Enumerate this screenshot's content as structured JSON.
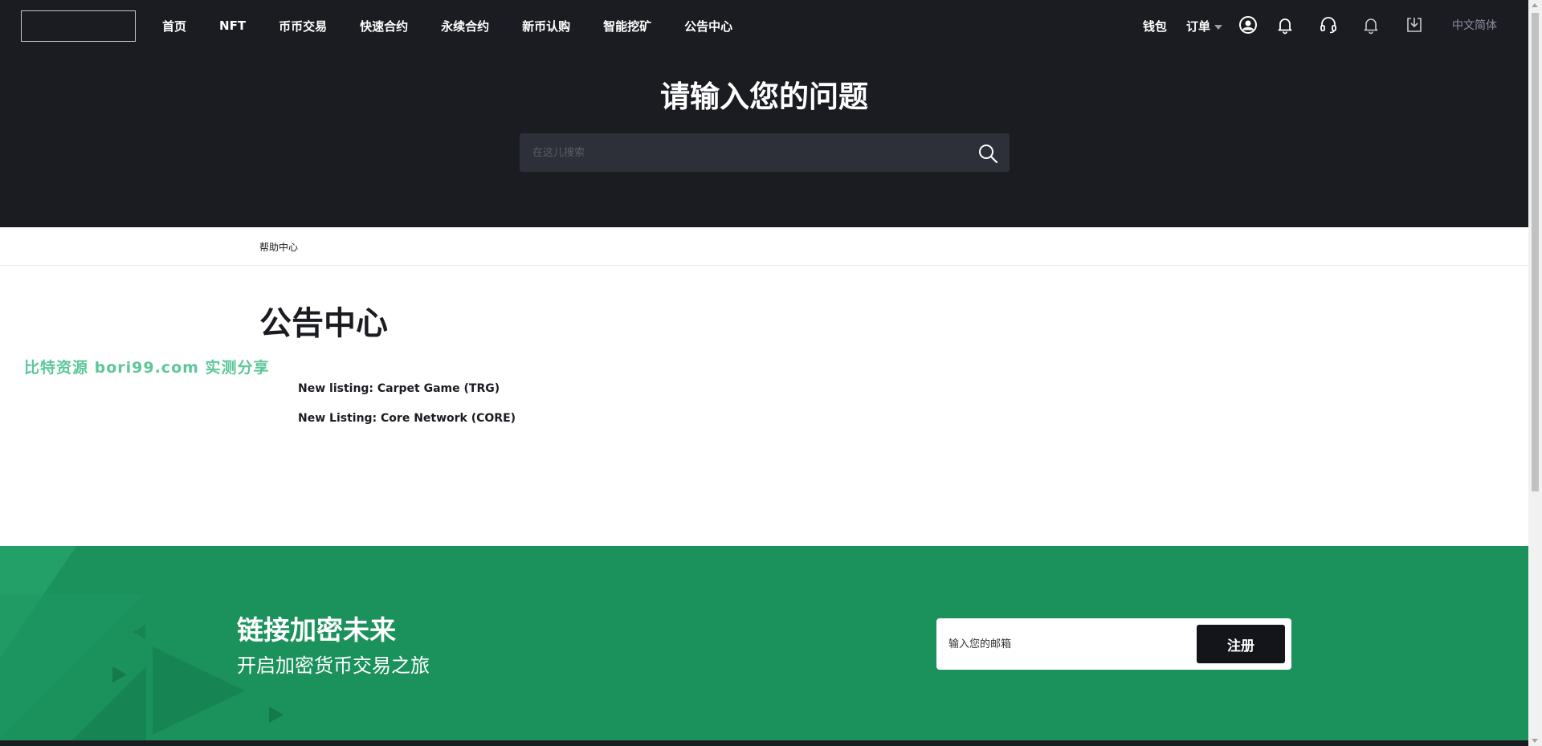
{
  "nav": {
    "items": [
      {
        "label": "首页"
      },
      {
        "label": "NFT"
      },
      {
        "label": "币币交易"
      },
      {
        "label": "快速合约"
      },
      {
        "label": "永续合约"
      },
      {
        "label": "新币认购"
      },
      {
        "label": "智能挖矿"
      },
      {
        "label": "公告中心"
      }
    ],
    "wallet_label": "钱包",
    "orders_label": "订单",
    "language_label": "中文简体",
    "icons": [
      "user-icon",
      "bell-icon",
      "headset-icon",
      "bell-icon",
      "download-icon"
    ]
  },
  "hero": {
    "title": "请输入您的问题",
    "search_placeholder": "在这儿搜索"
  },
  "breadcrumb": {
    "label": "帮助中心"
  },
  "content": {
    "title": "公告中心",
    "watermark": "比特资源 bori99.com 实测分享",
    "articles": [
      {
        "title": "New listing: Carpet Game (TRG)"
      },
      {
        "title": "New Listing: Core Network (CORE)"
      }
    ]
  },
  "banner": {
    "title": "链接加密未来",
    "subtitle": "开启加密货币交易之旅",
    "email_placeholder": "输入您的邮箱",
    "register_label": "注册"
  },
  "colors": {
    "header_bg": "#1b1c22",
    "banner_bg": "#1b915c",
    "button_bg": "#14151a",
    "watermark": "#5dc79a"
  }
}
